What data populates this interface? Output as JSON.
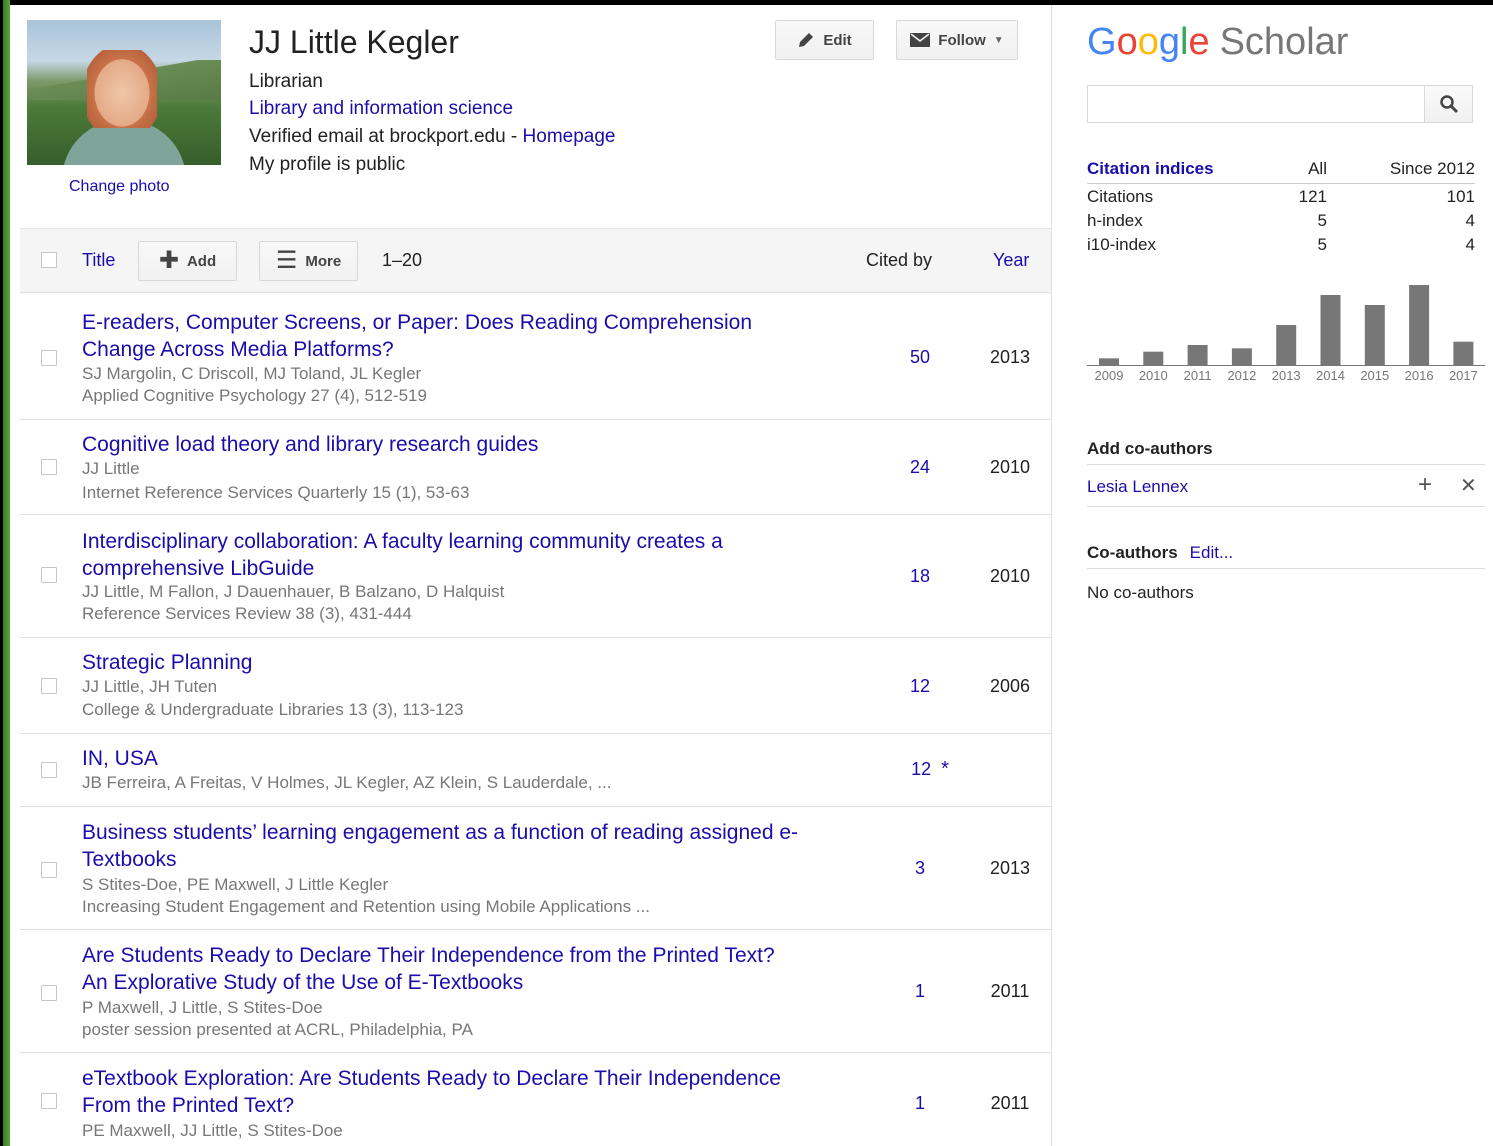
{
  "profile": {
    "name": "JJ Little Kegler",
    "affiliation": "Librarian",
    "interest": "Library and information science",
    "email_prefix": "Verified email at brockport.edu - ",
    "homepage_label": "Homepage",
    "visibility": "My profile is public",
    "change_photo_label": "Change photo"
  },
  "header_buttons": {
    "edit": "Edit",
    "follow": "Follow"
  },
  "toolbar": {
    "title_label": "Title",
    "add_label": "Add",
    "more_label": "More",
    "range": "1–20",
    "cited_by_label": "Cited by",
    "year_label": "Year"
  },
  "articles": [
    {
      "title": "E-readers, Computer Screens, or Paper: Does Reading Comprehension Change Across Media Platforms?",
      "authors": "SJ Margolin, C Driscoll, MJ Toland, JL Kegler",
      "venue": "Applied Cognitive Psychology 27 (4), 512-519",
      "cited_by": "50",
      "year": "2013"
    },
    {
      "title": "Cognitive load theory and library research guides",
      "authors": "JJ Little",
      "venue": "Internet Reference Services Quarterly 15 (1), 53-63",
      "cited_by": "24",
      "year": "2010"
    },
    {
      "title": "Interdisciplinary collaboration: A faculty learning community creates a comprehensive LibGuide",
      "authors": "JJ Little, M Fallon, J Dauenhauer, B Balzano, D Halquist",
      "venue": "Reference Services Review 38 (3), 431-444",
      "cited_by": "18",
      "year": "2010"
    },
    {
      "title": "Strategic Planning",
      "authors": "JJ Little, JH Tuten",
      "venue": "College & Undergraduate Libraries 13 (3), 113-123",
      "cited_by": "12",
      "year": "2006"
    },
    {
      "title": "IN, USA",
      "authors": "JB Ferreira, A Freitas, V Holmes, JL Kegler, AZ Klein, S Lauderdale, ...",
      "venue": "",
      "cited_by": "12",
      "cited_by_marker": "*",
      "year": ""
    },
    {
      "title": "Business students’ learning engagement as a function of reading assigned e-Textbooks",
      "authors": "S Stites-Doe, PE Maxwell, J Little Kegler",
      "venue": "Increasing Student Engagement and Retention using Mobile Applications ...",
      "cited_by": "3",
      "year": "2013"
    },
    {
      "title": "Are Students Ready to Declare Their Independence from the Printed Text? An Explorative Study of the Use of E-Textbooks",
      "authors": "P Maxwell, J Little, S Stites-Doe",
      "venue": "poster session presented at ACRL, Philadelphia, PA",
      "cited_by": "1",
      "year": "2011"
    },
    {
      "title": "eTextbook Exploration: Are Students Ready to Declare Their Independence From the Printed Text?",
      "authors": "PE Maxwell, JJ Little, S Stites-Doe",
      "venue": "",
      "cited_by": "1",
      "year": "2011"
    }
  ],
  "sidebar": {
    "logo_google": [
      "G",
      "o",
      "o",
      "g",
      "l",
      "e"
    ],
    "logo_scholar": "Scholar",
    "search_placeholder": "",
    "citation_indices": {
      "header": "Citation indices",
      "col_all": "All",
      "col_since": "Since 2012",
      "rows": [
        {
          "label": "Citations",
          "all": "121",
          "since": "101"
        },
        {
          "label": "h-index",
          "all": "5",
          "since": "4"
        },
        {
          "label": "i10-index",
          "all": "5",
          "since": "4"
        }
      ]
    },
    "add_coauthors_header": "Add co-authors",
    "suggested_coauthor": "Lesia Lennex",
    "coauthors_header": "Co-authors",
    "coauthors_edit": "Edit...",
    "no_coauthors": "No co-authors"
  },
  "chart_data": {
    "type": "bar",
    "categories": [
      "2009",
      "2010",
      "2011",
      "2012",
      "2013",
      "2014",
      "2015",
      "2016",
      "2017"
    ],
    "values": [
      2,
      4,
      6,
      5,
      12,
      21,
      18,
      24,
      7
    ],
    "bar_color": "#777777"
  },
  "colors": {
    "link": "#1a0dab",
    "toolbar_bg": "#f5f5f5"
  }
}
